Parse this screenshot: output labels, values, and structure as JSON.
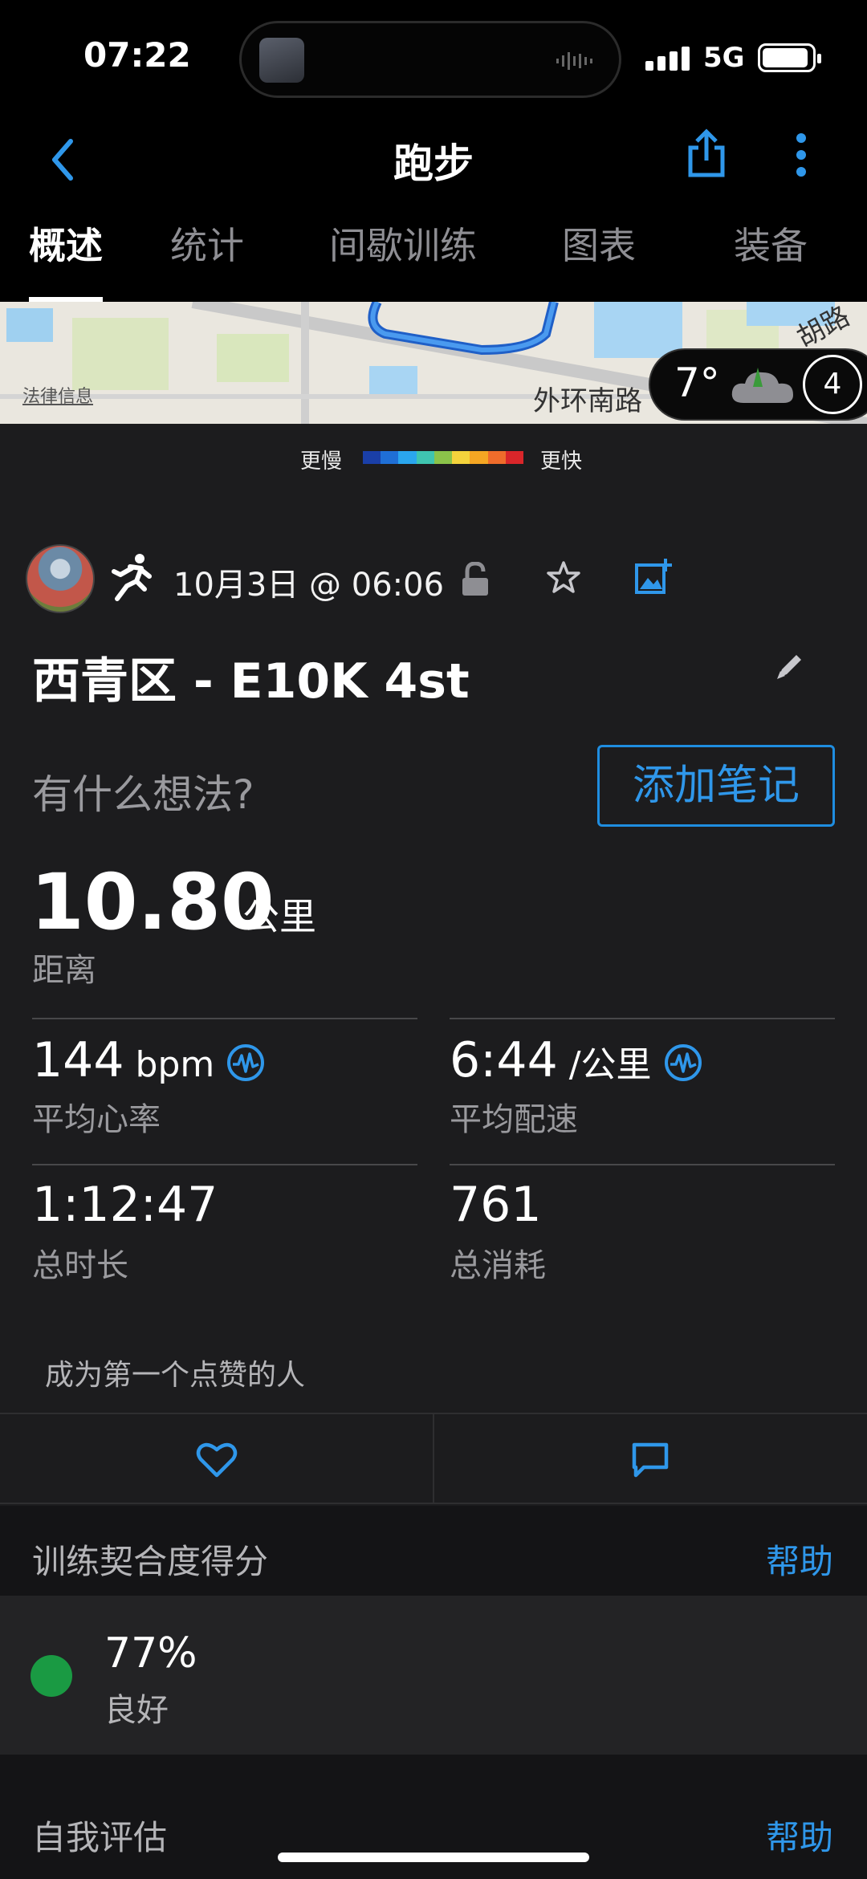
{
  "status_bar": {
    "time": "07:22",
    "network": "5G"
  },
  "nav": {
    "title": "跑步"
  },
  "tabs": [
    {
      "label": "概述",
      "active": true
    },
    {
      "label": "统计",
      "active": false
    },
    {
      "label": "间歇训练",
      "active": false
    },
    {
      "label": "图表",
      "active": false
    },
    {
      "label": "装备",
      "active": false
    }
  ],
  "map": {
    "legal_label": "法律信息",
    "road_label": "外环南路",
    "road_label_2": "胡路",
    "weather": {
      "temp": "7°",
      "badge": "4"
    }
  },
  "pace_legend": {
    "slow": "更慢",
    "fast": "更快",
    "colors": [
      "#1a3fa8",
      "#1f6fd6",
      "#2aa6ee",
      "#3fc4b0",
      "#8bc34a",
      "#f4d33c",
      "#f5a623",
      "#ef6c2b",
      "#d9262a"
    ]
  },
  "activity": {
    "date": "10月3日 @ 06:06",
    "title": "西青区 - E10K 4st",
    "thoughts_placeholder": "有什么想法?",
    "add_note_label": "添加笔记"
  },
  "stats": {
    "distance": {
      "value": "10.80",
      "unit": "公里",
      "label": "距离"
    },
    "avg_hr": {
      "value": "144",
      "unit": " bpm",
      "label": "平均心率"
    },
    "avg_pace": {
      "value": "6:44",
      "unit": " /公里",
      "label": "平均配速"
    },
    "duration": {
      "value": "1:12:47",
      "label": "总时长"
    },
    "calories": {
      "value": "761",
      "label": "总消耗"
    }
  },
  "social": {
    "likes_text": "成为第一个点赞的人"
  },
  "training_fit": {
    "title": "训练契合度得分",
    "help": "帮助",
    "score": "77%",
    "rating": "良好",
    "status_color": "#1a9a43"
  },
  "self_eval": {
    "title": "自我评估",
    "help": "帮助"
  },
  "colors": {
    "accent": "#2f97ea",
    "background": "#1c1c1e"
  }
}
